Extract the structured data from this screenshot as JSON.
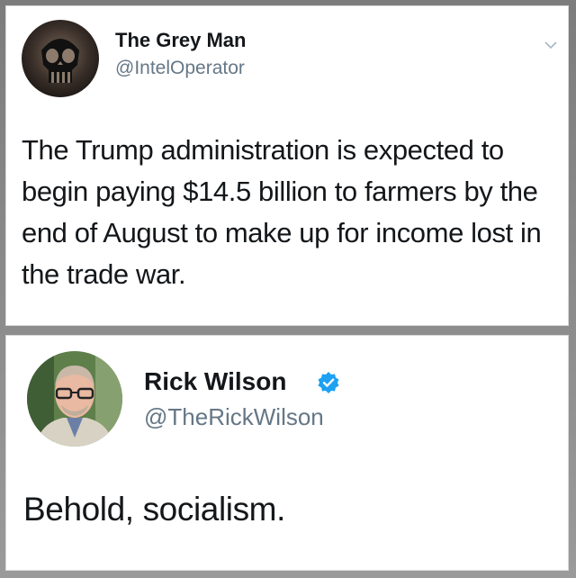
{
  "tweets": [
    {
      "display_name": "The Grey Man",
      "handle": "@IntelOperator",
      "text": "The Trump administration is expected to begin paying $14.5 billion to farmers by the end of August to make up for income lost in the trade war.",
      "menu_icon": "chevron-down-icon",
      "avatar_icon": "skull-emblem-avatar"
    },
    {
      "display_name": "Rick Wilson",
      "handle": "@TheRickWilson",
      "verified": true,
      "verified_icon": "verified-badge-icon",
      "text": "Behold, socialism.",
      "avatar_icon": "person-avatar"
    }
  ],
  "colors": {
    "verified_blue": "#1da1f2",
    "handle_gray": "#657786",
    "text": "#14171a"
  }
}
